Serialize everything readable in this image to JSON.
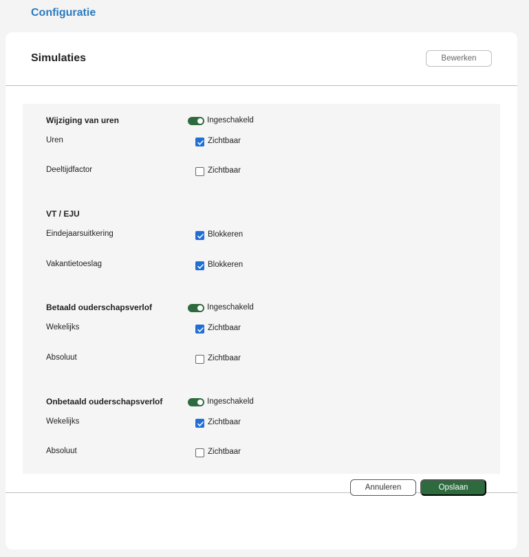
{
  "header": {
    "title": "Configuratie"
  },
  "card": {
    "title": "Simulaties",
    "edit_label": "Bewerken"
  },
  "sections": [
    {
      "title": "Wijziging van uren",
      "toggle": {
        "enabled": true,
        "label": "Ingeschakeld"
      },
      "rows": [
        {
          "label": "Uren",
          "checked": true,
          "check_label": "Zichtbaar"
        },
        {
          "label": "Deeltijdfactor",
          "checked": false,
          "check_label": "Zichtbaar"
        }
      ]
    },
    {
      "title": "VT / EJU",
      "rows": [
        {
          "label": "Eindejaarsuitkering",
          "checked": true,
          "check_label": "Blokkeren"
        },
        {
          "label": "Vakantietoeslag",
          "checked": true,
          "check_label": "Blokkeren"
        }
      ]
    },
    {
      "title": "Betaald ouderschapsverlof",
      "toggle": {
        "enabled": true,
        "label": "Ingeschakeld"
      },
      "rows": [
        {
          "label": "Wekelijks",
          "checked": true,
          "check_label": "Zichtbaar"
        },
        {
          "label": "Absoluut",
          "checked": false,
          "check_label": "Zichtbaar"
        }
      ]
    },
    {
      "title": "Onbetaald ouderschapsverlof",
      "toggle": {
        "enabled": true,
        "label": "Ingeschakeld"
      },
      "rows": [
        {
          "label": "Wekelijks",
          "checked": true,
          "check_label": "Zichtbaar"
        },
        {
          "label": "Absoluut",
          "checked": false,
          "check_label": "Zichtbaar"
        }
      ]
    }
  ],
  "footer": {
    "cancel_label": "Annuleren",
    "save_label": "Opslaan"
  },
  "colors": {
    "accent_blue": "#2b7bbf",
    "toggle_green": "#2d6a3e",
    "checkbox_blue": "#1f6fd6",
    "save_green": "#2d6a3e"
  }
}
